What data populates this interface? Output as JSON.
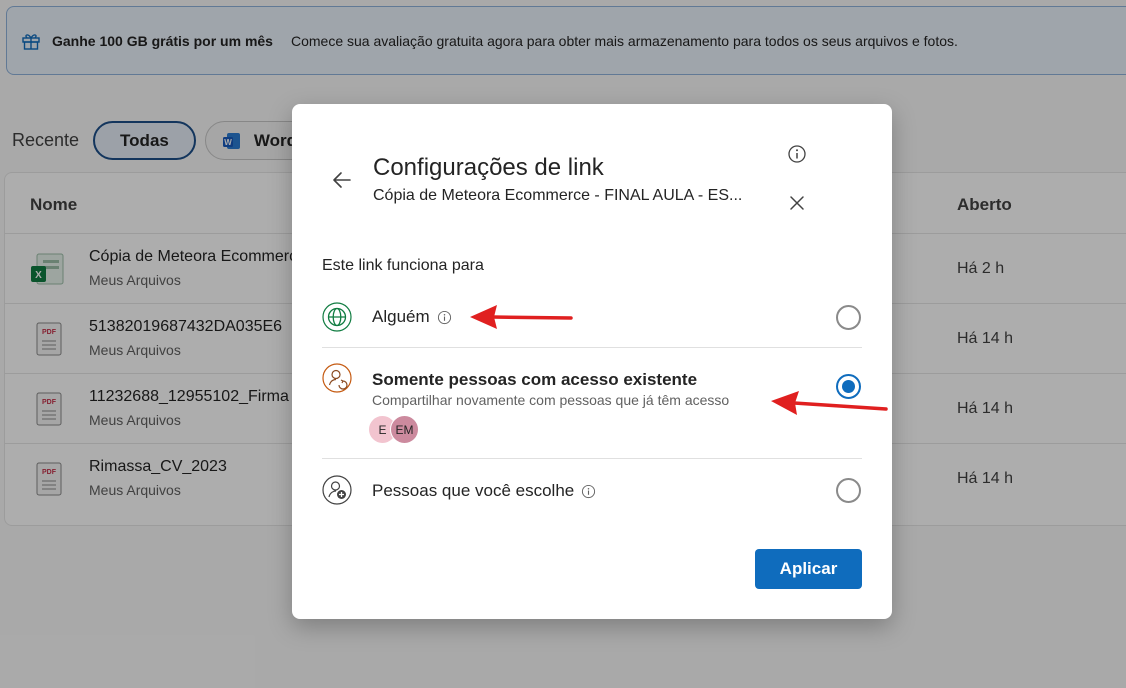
{
  "banner": {
    "title": "Ganhe 100 GB grátis por um mês",
    "text": "Comece sua avaliação gratuita agora para obter mais armazenamento para todos os seus arquivos e fotos."
  },
  "filters": {
    "recent_label": "Recente",
    "chip_all": "Todas",
    "chip_word": "Word"
  },
  "table": {
    "col_name": "Nome",
    "col_opened": "Aberto",
    "rows": [
      {
        "name": "Cópia de Meteora Ecommerce",
        "location": "Meus Arquivos",
        "opened": "Há 2 h",
        "icon": "excel-icon"
      },
      {
        "name": "51382019687432DA035E6",
        "location": "Meus Arquivos",
        "opened": "Há 14 h",
        "icon": "pdf-icon"
      },
      {
        "name": "11232688_12955102_Firma",
        "location": "Meus Arquivos",
        "opened": "Há 14 h",
        "icon": "pdf-icon"
      },
      {
        "name": "Rimassa_CV_2023",
        "location": "Meus Arquivos",
        "opened": "Há 14 h",
        "icon": "pdf-icon"
      }
    ]
  },
  "dialog": {
    "title": "Configurações de link",
    "subtitle": "Cópia de Meteora Ecommerce - FINAL AULA - ES...",
    "section_label": "Este link funciona para",
    "options": [
      {
        "label": "Alguém",
        "selected": false
      },
      {
        "label": "Somente pessoas com acesso existente",
        "description": "Compartilhar novamente com pessoas que já têm acesso",
        "selected": true
      },
      {
        "label": "Pessoas que você escolhe",
        "selected": false
      }
    ],
    "avatars": [
      "E",
      "EM"
    ],
    "apply_label": "Aplicar"
  },
  "colors": {
    "accent": "#0f6cbd",
    "annotation_arrow": "#e02020"
  }
}
